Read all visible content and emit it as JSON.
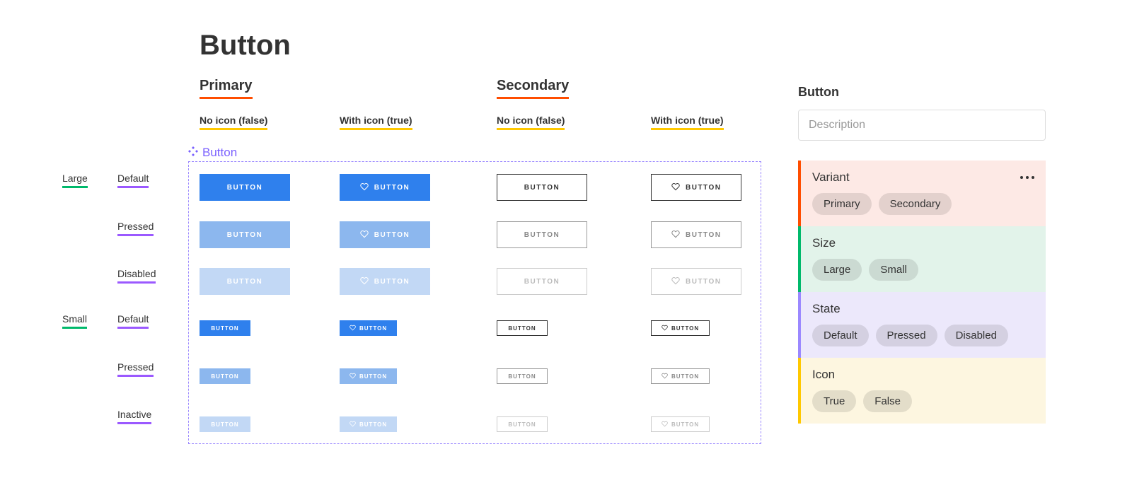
{
  "title": "Button",
  "columns": {
    "primary": "Primary",
    "secondary": "Secondary"
  },
  "subcolumns": {
    "no_icon": "No icon (false)",
    "with_icon": "With icon (true)"
  },
  "frame_label": "Button",
  "sizes": {
    "large": "Large",
    "small": "Small"
  },
  "states": {
    "default": "Default",
    "pressed": "Pressed",
    "disabled": "Disabled",
    "inactive": "Inactive"
  },
  "button_text": "BUTTON",
  "panel": {
    "title": "Button",
    "description_placeholder": "Description",
    "properties": [
      {
        "name": "Variant",
        "pills": [
          "Primary",
          "Secondary"
        ],
        "show_menu": true
      },
      {
        "name": "Size",
        "pills": [
          "Large",
          "Small"
        ],
        "show_menu": false
      },
      {
        "name": "State",
        "pills": [
          "Default",
          "Pressed",
          "Disabled"
        ],
        "show_menu": false
      },
      {
        "name": "Icon",
        "pills": [
          "True",
          "False"
        ],
        "show_menu": false
      }
    ]
  }
}
